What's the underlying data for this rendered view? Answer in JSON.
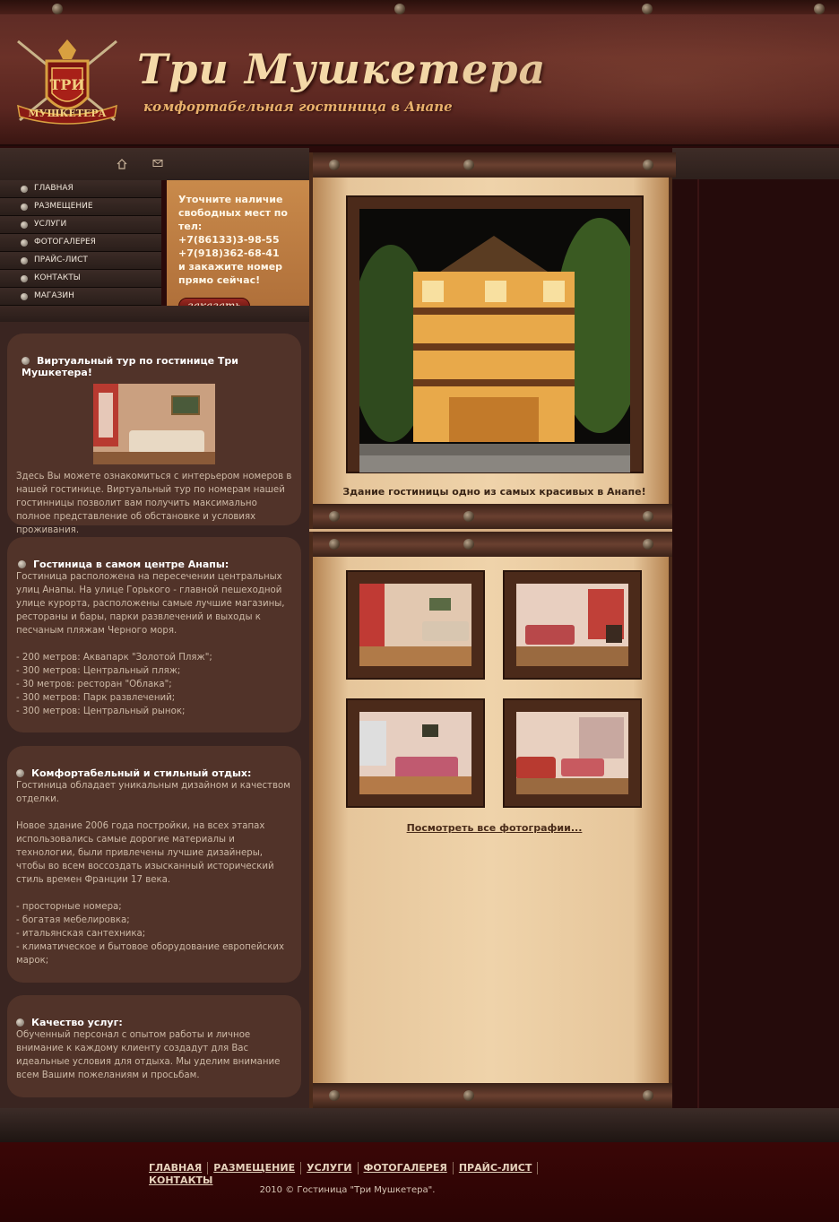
{
  "header": {
    "title": "Три Мушкетера",
    "subtitle": "комфортабельная гостиница в Анапе",
    "logo_text": "МУШКЕТЕРА"
  },
  "icons": {
    "home": "home-icon",
    "mail": "mail-icon"
  },
  "nav": {
    "items": [
      {
        "label": "ГЛАВНАЯ"
      },
      {
        "label": "РАЗМЕЩЕНИЕ"
      },
      {
        "label": "УСЛУГИ"
      },
      {
        "label": "ФОТОГАЛЕРЕЯ"
      },
      {
        "label": "ПРАЙС-ЛИСТ"
      },
      {
        "label": "КОНТАКТЫ"
      },
      {
        "label": "МАГАЗИН"
      }
    ]
  },
  "booking": {
    "text": "Уточните наличие свободных мест по тел:\n+7(86133)3-98-55\n+7(918)362-68-41\nи закажите номер прямо сейчас!",
    "button": "заказать"
  },
  "sections": [
    {
      "title": "Виртуальный тур по гостинице Три Мушкетера!",
      "text": "Здесь Вы можете ознакомиться с интерьером номеров в нашей гостинице. Виртуальный тур по номерам нашей гостинницы позволит вам получить максимально полное представление об обстановке и условиях проживания."
    },
    {
      "title": "Гостиница в самом центре Анапы:",
      "text": "Гостиница расположена на пересечении центральных улиц Анапы. На улице Горького - главной пешеходной улице курорта, расположены самые лучшие магазины, рестораны и бары, парки развлечений и выходы к песчаным пляжам Черного моря.\n\n- 200 метров: Аквапарк \"Золотой Пляж\";\n- 300 метров: Центральный пляж;\n- 30 метров:   ресторан \"Облака\";\n- 300 метров: Парк развлечений;\n- 300 метров: Центральный рынок;"
    },
    {
      "title": "Комфортабельный и стильный отдых:",
      "text": "Гостиница обладает уникальным дизайном и качеством отделки.\n\nНовое здание 2006 года постройки, на всех этапах использовались самые дорогие материалы и технологии, были привлечены лучшие дизайнеры, чтобы во всем воссоздать изысканный исторический стиль времен Франции 17 века.\n\n- просторные номера;\n- богатая мебелировка;\n- итальянская сантехника;\n- климатическое и бытовое оборудование европейских марок;"
    },
    {
      "title": "Качество услуг:",
      "text": "Обученный персонал с опытом работы и личное внимание к каждому клиенту создадут для Вас идеальные условия для отдыха. Мы уделим внимание всем Вашим пожеланиям и просьбам."
    }
  ],
  "main": {
    "caption": "Здание гостиницы одно из самых красивых в Анапе!",
    "all_photos": "Посмотреть все фотографии..."
  },
  "footer": {
    "nav": [
      "ГЛАВНАЯ",
      "РАЗМЕЩЕНИЕ",
      "УСЛУГИ",
      "ФОТОГАЛЕРЕЯ",
      "ПРАЙС-ЛИСТ",
      "КОНТАКТЫ"
    ],
    "copyright": "2010 © Гостиница \"Три Мушкетера\"."
  }
}
